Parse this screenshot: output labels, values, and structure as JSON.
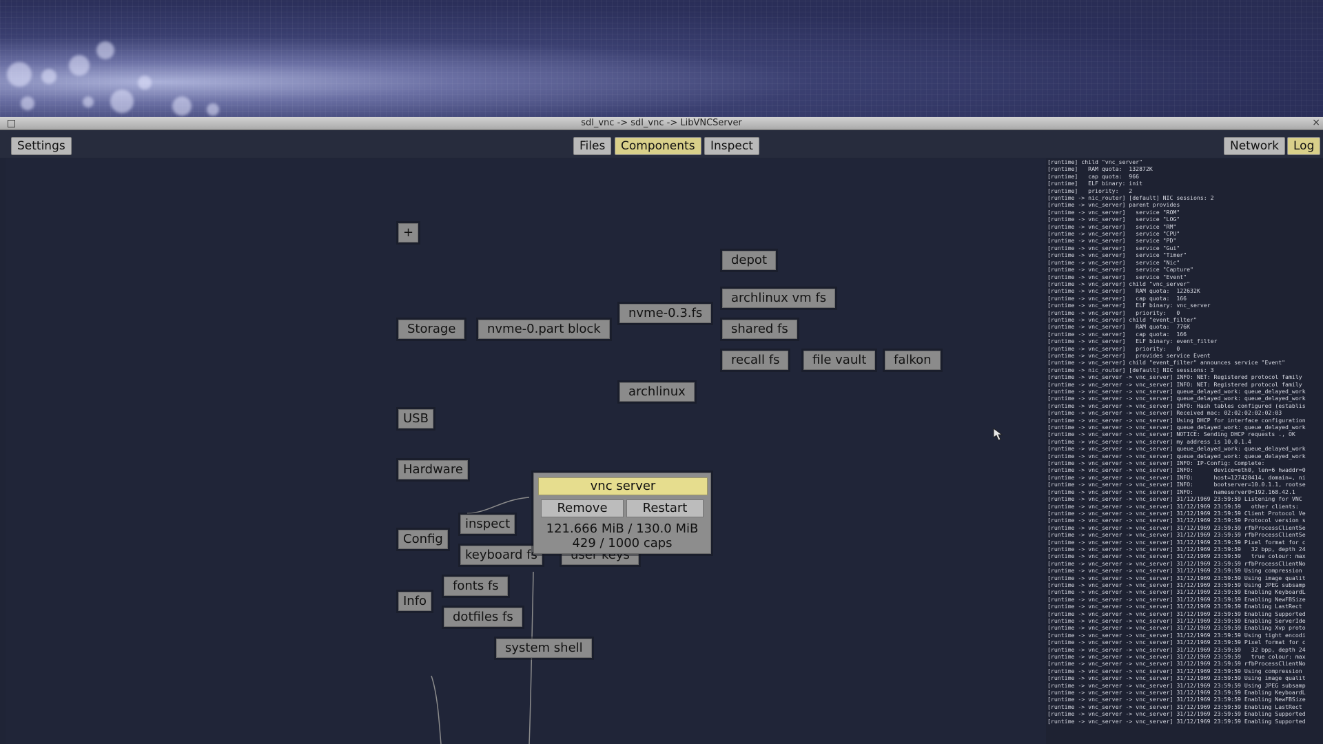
{
  "window": {
    "title": "sdl_vnc -> sdl_vnc -> LibVNCServer",
    "close": "×"
  },
  "toolbar": {
    "settings": "Settings",
    "files": "Files",
    "components": "Components",
    "inspect": "Inspect",
    "network": "Network",
    "log": "Log"
  },
  "graph": {
    "add": "+",
    "storage": "Storage",
    "nvme_part_block": "nvme-0.part block",
    "nvme_fs": "nvme-0.3.fs",
    "depot": "depot",
    "archlinux_vm_fs": "archlinux vm fs",
    "shared_fs": "shared fs",
    "recall_fs": "recall fs",
    "file_vault": "file vault",
    "falkon": "falkon",
    "archlinux": "archlinux",
    "usb": "USB",
    "hardware": "Hardware",
    "config": "Config",
    "inspect": "inspect",
    "keyboard_fs": "keyboard fs",
    "user_keys": "user keys",
    "info": "Info",
    "fonts_fs": "fonts fs",
    "dotfiles_fs": "dotfiles fs",
    "system_shell": "system shell"
  },
  "popup": {
    "title": "vnc server",
    "remove": "Remove",
    "restart": "Restart",
    "ram": "121.666 MiB / 130.0 MiB",
    "caps": "429 / 1000 caps"
  },
  "log": [
    "[runtime] child \"vnc_server\"",
    "[runtime]   RAM quota:  132872K",
    "[runtime]   cap quota:  966",
    "[runtime]   ELF binary: init",
    "[runtime]   priority:   2",
    "[runtime -> nic_router] [default] NIC sessions: 2",
    "[runtime -> vnc_server] parent provides",
    "[runtime -> vnc_server]   service \"ROM\"",
    "[runtime -> vnc_server]   service \"LOG\"",
    "[runtime -> vnc_server]   service \"RM\"",
    "[runtime -> vnc_server]   service \"CPU\"",
    "[runtime -> vnc_server]   service \"PD\"",
    "[runtime -> vnc_server]   service \"Gui\"",
    "[runtime -> vnc_server]   service \"Timer\"",
    "[runtime -> vnc_server]   service \"Nic\"",
    "[runtime -> vnc_server]   service \"Capture\"",
    "[runtime -> vnc_server]   service \"Event\"",
    "[runtime -> vnc_server] child \"vnc_server\"",
    "[runtime -> vnc_server]   RAM quota:  122632K",
    "[runtime -> vnc_server]   cap quota:  166",
    "[runtime -> vnc_server]   ELF binary: vnc_server",
    "[runtime -> vnc_server]   priority:   0",
    "[runtime -> vnc_server] child \"event_filter\"",
    "[runtime -> vnc_server]   RAM quota:  776K",
    "[runtime -> vnc_server]   cap quota:  166",
    "[runtime -> vnc_server]   ELF binary: event_filter",
    "[runtime -> vnc_server]   priority:   0",
    "[runtime -> vnc_server]   provides service Event",
    "[runtime -> vnc_server] child \"event_filter\" announces service \"Event\"",
    "[runtime -> nic_router] [default] NIC sessions: 3",
    "[runtime -> vnc_server -> vnc_server] INFO: NET: Registered protocol family",
    "[runtime -> vnc_server -> vnc_server] INFO: NET: Registered protocol family",
    "[runtime -> vnc_server -> vnc_server] queue_delayed_work: queue_delayed_work",
    "[runtime -> vnc_server -> vnc_server] queue_delayed_work: queue_delayed_work",
    "[runtime -> vnc_server -> vnc_server] INFO: Hash tables configured (establis",
    "[runtime -> vnc_server -> vnc_server] Received mac: 02:02:02:02:02:03",
    "[runtime -> vnc_server -> vnc_server] Using DHCP for interface configuration",
    "[runtime -> vnc_server -> vnc_server] queue_delayed_work: queue_delayed_work",
    "[runtime -> vnc_server -> vnc_server] NOTICE: Sending DHCP requests ., OK",
    "[runtime -> vnc_server -> vnc_server] my address is 10.0.1.4",
    "[runtime -> vnc_server -> vnc_server] queue_delayed_work: queue_delayed_work",
    "[runtime -> vnc_server -> vnc_server] queue_delayed_work: queue_delayed_work",
    "[runtime -> vnc_server -> vnc_server] INFO: IP-Config: Complete:",
    "[runtime -> vnc_server -> vnc_server] INFO:      device=eth0, len=6 hwaddr=0",
    "[runtime -> vnc_server -> vnc_server] INFO:      host=127420414, domain=, ni",
    "[runtime -> vnc_server -> vnc_server] INFO:      bootserver=10.0.1.1, rootse",
    "[runtime -> vnc_server -> vnc_server] INFO:      nameserver0=192.168.42.1",
    "[runtime -> vnc_server -> vnc_server] 31/12/1969 23:59:59 Listening for VNC",
    "[runtime -> vnc_server -> vnc_server] 31/12/1969 23:59:59   other clients:",
    "[runtime -> vnc_server -> vnc_server] 31/12/1969 23:59:59 Client Protocol Ve",
    "[runtime -> vnc_server -> vnc_server] 31/12/1969 23:59:59 Protocol version s",
    "[runtime -> vnc_server -> vnc_server] 31/12/1969 23:59:59 rfbProcessClientSe",
    "[runtime -> vnc_server -> vnc_server] 31/12/1969 23:59:59 rfbProcessClientSe",
    "[runtime -> vnc_server -> vnc_server] 31/12/1969 23:59:59 Pixel format for c",
    "[runtime -> vnc_server -> vnc_server] 31/12/1969 23:59:59   32 bpp, depth 24",
    "[runtime -> vnc_server -> vnc_server] 31/12/1969 23:59:59   true colour: max",
    "[runtime -> vnc_server -> vnc_server] 31/12/1969 23:59:59 rfbProcessClientNo",
    "[runtime -> vnc_server -> vnc_server] 31/12/1969 23:59:59 Using compression",
    "[runtime -> vnc_server -> vnc_server] 31/12/1969 23:59:59 Using image qualit",
    "[runtime -> vnc_server -> vnc_server] 31/12/1969 23:59:59 Using JPEG subsamp",
    "[runtime -> vnc_server -> vnc_server] 31/12/1969 23:59:59 Enabling KeyboardL",
    "[runtime -> vnc_server -> vnc_server] 31/12/1969 23:59:59 Enabling NewFBSize",
    "[runtime -> vnc_server -> vnc_server] 31/12/1969 23:59:59 Enabling LastRect",
    "[runtime -> vnc_server -> vnc_server] 31/12/1969 23:59:59 Enabling Supported",
    "[runtime -> vnc_server -> vnc_server] 31/12/1969 23:59:59 Enabling ServerIde",
    "[runtime -> vnc_server -> vnc_server] 31/12/1969 23:59:59 Enabling Xvp proto",
    "[runtime -> vnc_server -> vnc_server] 31/12/1969 23:59:59 Using tight encodi",
    "[runtime -> vnc_server -> vnc_server] 31/12/1969 23:59:59 Pixel format for c",
    "[runtime -> vnc_server -> vnc_server] 31/12/1969 23:59:59   32 bpp, depth 24",
    "[runtime -> vnc_server -> vnc_server] 31/12/1969 23:59:59   true colour: max",
    "[runtime -> vnc_server -> vnc_server] 31/12/1969 23:59:59 rfbProcessClientNo",
    "[runtime -> vnc_server -> vnc_server] 31/12/1969 23:59:59 Using compression",
    "[runtime -> vnc_server -> vnc_server] 31/12/1969 23:59:59 Using image qualit",
    "[runtime -> vnc_server -> vnc_server] 31/12/1969 23:59:59 Using JPEG subsamp",
    "[runtime -> vnc_server -> vnc_server] 31/12/1969 23:59:59 Enabling KeyboardL",
    "[runtime -> vnc_server -> vnc_server] 31/12/1969 23:59:59 Enabling NewFBSize",
    "[runtime -> vnc_server -> vnc_server] 31/12/1969 23:59:59 Enabling LastRect",
    "[runtime -> vnc_server -> vnc_server] 31/12/1969 23:59:59 Enabling Supported",
    "[runtime -> vnc_server -> vnc_server] 31/12/1969 23:59:59 Enabling Supported"
  ]
}
